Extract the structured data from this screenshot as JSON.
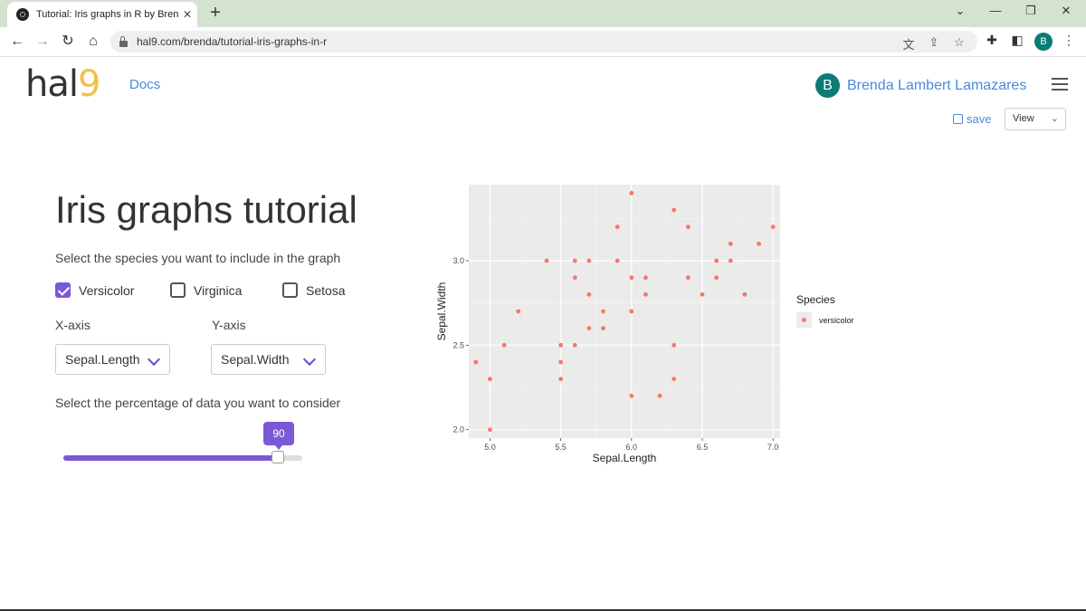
{
  "browser": {
    "tab_title": "Tutorial: Iris graphs in R by Brenda",
    "tab_close": "✕",
    "new_tab": "+",
    "url": "hal9.com/brenda/tutorial-iris-graphs-in-r",
    "profile_initial": "B"
  },
  "header": {
    "logo_text": "hal",
    "logo_digit": "9",
    "docs_link": "Docs",
    "avatar_initial": "B",
    "user_name": "Brenda Lambert Lamazares",
    "save_label": "save",
    "view_select": "View"
  },
  "main": {
    "title": "Iris graphs tutorial",
    "species_prompt": "Select the species you want to include in the graph",
    "species": [
      {
        "label": "Versicolor",
        "checked": true
      },
      {
        "label": "Virginica",
        "checked": false
      },
      {
        "label": "Setosa",
        "checked": false
      }
    ],
    "x_axis_label": "X-axis",
    "x_axis_value": "Sepal.Length",
    "y_axis_label": "Y-axis",
    "y_axis_value": "Sepal.Width",
    "percentage_prompt": "Select the percentage of data you want to consider",
    "percentage_value": "90",
    "percentage_fraction": 0.9
  },
  "colors": {
    "accent": "#7b59d6",
    "link": "#4a89dc",
    "point": "#f8766d",
    "panel": "#ebebeb"
  },
  "chart_data": {
    "type": "scatter",
    "xlabel": "Sepal.Length",
    "ylabel": "Sepal.Width",
    "xlim": [
      4.85,
      7.05
    ],
    "ylim": [
      1.95,
      3.45
    ],
    "x_ticks": [
      "5.0",
      "5.5",
      "6.0",
      "6.5",
      "7.0"
    ],
    "x_tick_values": [
      5.0,
      5.5,
      6.0,
      6.5,
      7.0
    ],
    "y_ticks": [
      "2.0",
      "2.5",
      "3.0"
    ],
    "y_tick_values": [
      2.0,
      2.5,
      3.0
    ],
    "grid": true,
    "legend_title": "Species",
    "legend_position": "right",
    "series": [
      {
        "name": "versicolor",
        "points": [
          [
            7.0,
            3.2
          ],
          [
            6.4,
            3.2
          ],
          [
            6.9,
            3.1
          ],
          [
            5.5,
            2.3
          ],
          [
            6.5,
            2.8
          ],
          [
            5.7,
            2.8
          ],
          [
            6.3,
            3.3
          ],
          [
            4.9,
            2.4
          ],
          [
            6.6,
            2.9
          ],
          [
            5.2,
            2.7
          ],
          [
            5.0,
            2.0
          ],
          [
            5.9,
            3.0
          ],
          [
            6.0,
            2.2
          ],
          [
            6.1,
            2.9
          ],
          [
            5.6,
            2.9
          ],
          [
            6.7,
            3.1
          ],
          [
            5.6,
            3.0
          ],
          [
            5.8,
            2.7
          ],
          [
            6.2,
            2.2
          ],
          [
            5.6,
            2.5
          ],
          [
            5.9,
            3.2
          ],
          [
            6.1,
            2.8
          ],
          [
            6.3,
            2.5
          ],
          [
            6.4,
            2.9
          ],
          [
            6.6,
            3.0
          ],
          [
            6.8,
            2.8
          ],
          [
            6.7,
            3.0
          ],
          [
            6.0,
            2.9
          ],
          [
            5.7,
            2.6
          ],
          [
            5.5,
            2.4
          ],
          [
            5.5,
            2.5
          ],
          [
            5.8,
            2.6
          ],
          [
            6.0,
            2.7
          ],
          [
            5.4,
            3.0
          ],
          [
            6.0,
            3.4
          ],
          [
            6.3,
            2.3
          ],
          [
            5.0,
            2.3
          ],
          [
            5.1,
            2.5
          ],
          [
            5.7,
            3.0
          ],
          [
            4.9,
            2.4
          ]
        ]
      }
    ]
  }
}
